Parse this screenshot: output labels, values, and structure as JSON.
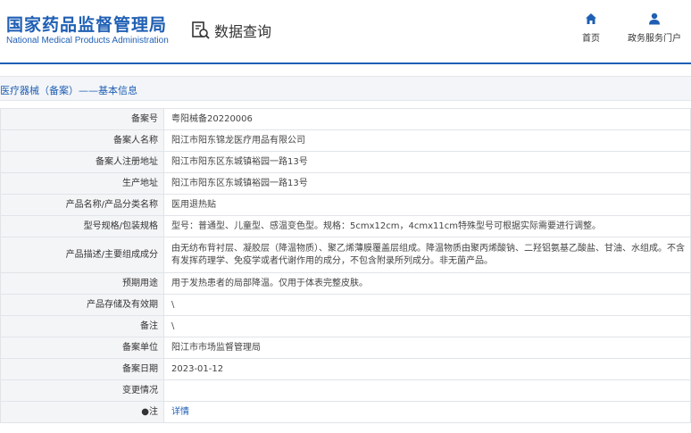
{
  "header": {
    "logo_cn": "国家药品监督管理局",
    "logo_en": "National Medical Products Administration",
    "search_title": "数据查询",
    "nav": [
      {
        "label": "首页",
        "icon": "home-icon"
      },
      {
        "label": "政务服务门户",
        "icon": "user-icon"
      }
    ],
    "accent_color": "#1f5fb4"
  },
  "section": {
    "title": "医疗器械（备案）——基本信息"
  },
  "rows": [
    {
      "key": "备案号",
      "value": "粤阳械备20220006"
    },
    {
      "key": "备案人名称",
      "value": "阳江市阳东锦龙医疗用品有限公司"
    },
    {
      "key": "备案人注册地址",
      "value": "阳江市阳东区东城镇裕园一路13号"
    },
    {
      "key": "生产地址",
      "value": "阳江市阳东区东城镇裕园一路13号"
    },
    {
      "key": "产品名称/产品分类名称",
      "value": "医用退热贴"
    },
    {
      "key": "型号规格/包装规格",
      "value": "型号：普通型、儿童型、感温变色型。规格：5cmx12cm，4cmx11cm特殊型号可根据实际需要进行调整。"
    },
    {
      "key": "产品描述/主要组成成分",
      "value": "由无纺布背衬层、凝胶层（降温物质）、聚乙烯薄膜覆盖层组成。降温物质由聚丙烯酸钠、二羟铝氨基乙酸盐、甘油、水组成。不含有发挥药理学、免疫学或者代谢作用的成分，不包含附录所列成分。非无菌产品。"
    },
    {
      "key": "预期用途",
      "value": "用于发热患者的局部降温。仅用于体表完整皮肤。"
    },
    {
      "key": "产品存储及有效期",
      "value": "\\"
    },
    {
      "key": "备注",
      "value": "\\"
    },
    {
      "key": "备案单位",
      "value": "阳江市市场监督管理局"
    },
    {
      "key": "备案日期",
      "value": "2023-01-12"
    },
    {
      "key": "变更情况",
      "value": ""
    },
    {
      "key": "●注",
      "value": "详情"
    }
  ]
}
